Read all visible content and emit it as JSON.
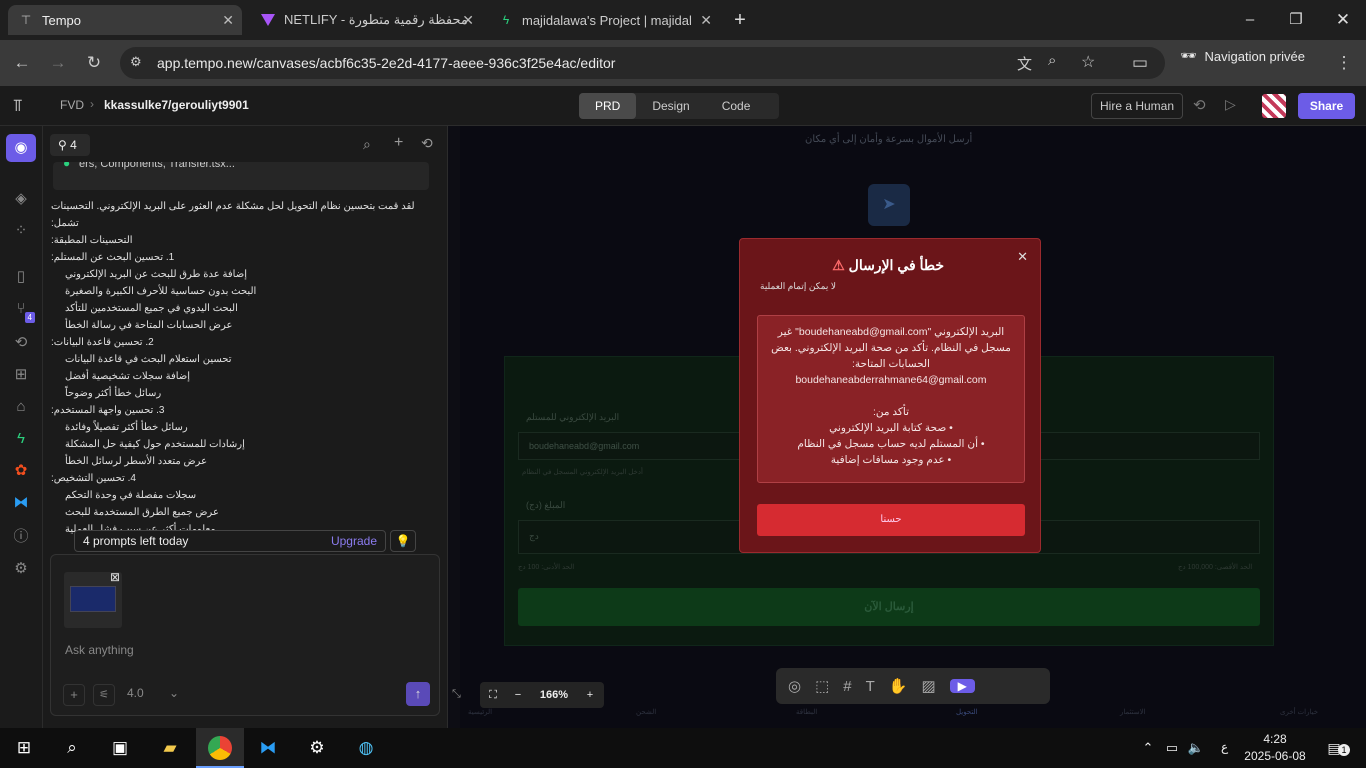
{
  "browser": {
    "tabs": [
      {
        "title": "Tempo",
        "active": true
      },
      {
        "title": "NETLIFY - محفظة رقمية متطورة",
        "active": false
      },
      {
        "title": "majidalawa's Project | majidalaw",
        "active": false
      }
    ],
    "url": "app.tempo.new/canvases/acbf6c35-2e2d-4177-aeee-936c3f25e4ac/editor",
    "private_label": "Navigation privée"
  },
  "app": {
    "breadcrumb_org": "FVD",
    "breadcrumb_project": "kkassulke7/gerouliyt9901",
    "modes": [
      {
        "label": "PRD"
      },
      {
        "label": "Design"
      },
      {
        "label": "Code"
      }
    ],
    "code_badge": "4",
    "hire_label": "Hire a Human",
    "share_label": "Share",
    "rail_badge": "4"
  },
  "chat": {
    "count": "4",
    "hidden_row": "ers, Components, Transfer.tsx...",
    "intro": "لقد قمت بتحسين نظام التحويل لحل مشكلة عدم العثور على البريد الإلكتروني. التحسينات تشمل:",
    "applied_title": "التحسينات المطبقة:",
    "sections": [
      {
        "title": "1. تحسين البحث عن المستلم:",
        "items": [
          "إضافة عدة طرق للبحث عن البريد الإلكتروني",
          "البحث بدون حساسية للأحرف الكبيرة والصغيرة",
          "البحث اليدوي في جميع المستخدمين للتأكد",
          "عرض الحسابات المتاحة في رسالة الخطأ"
        ]
      },
      {
        "title": "2. تحسين قاعدة البيانات:",
        "items": [
          "تحسين استعلام البحث في قاعدة البيانات",
          "إضافة سجلات تشخيصية أفضل",
          "رسائل خطأ أكثر وضوحاً"
        ]
      },
      {
        "title": "3. تحسين واجهة المستخدم:",
        "items": [
          "رسائل خطأ أكثر تفصيلاً وفائدة",
          "إرشادات للمستخدم حول كيفية حل المشكلة",
          "عرض متعدد الأسطر لرسائل الخطأ"
        ]
      },
      {
        "title": "4. تحسين التشخيص:",
        "items": [
          "سجلات مفصلة في وحدة التحكم",
          "عرض جميع الطرق المستخدمة للبحث",
          "معلومات أكثر عن سبب فشل العملية"
        ]
      }
    ],
    "prompts_left": "4 prompts left today",
    "upgrade_label": "Upgrade",
    "placeholder": "Ask anything",
    "model": "4.0"
  },
  "preview": {
    "header_sub": "أرسل الأموال بسرعة وأمان إلى أي مكان",
    "email_label": "البريد الإلكتروني للمستلم",
    "email_value": "boudehaneabd@gmail.com",
    "email_hint": "أدخل البريد الإلكتروني المسجل في النظام",
    "amount_label": "المبلغ (دج)",
    "amount_placeholder": "دج",
    "min_note": "الحد الأدنى: 100 دج",
    "max_note": "الحد الأقصى: 100,000 دج",
    "send_btn": "إرسال الآن",
    "nav": [
      "الرئيسية",
      "الشحن",
      "البطاقة",
      "التحويل",
      "الاستثمار",
      "خيارات أخرى"
    ]
  },
  "modal": {
    "title": "خطأ في الإرسال",
    "subtitle": "لا يمكن إتمام العملية",
    "line1": "البريد الإلكتروني \"boudehaneabd@gmail.com\" غير مسجل في النظام. تأكد من صحة البريد الإلكتروني. بعض الحسابات المتاحة:",
    "account": "boudehaneabderrahmane64@gmail.com",
    "check_title": "تأكد من:",
    "checks": [
      "• صحة كتابة البريد الإلكتروني",
      "• أن المستلم لديه حساب مسجل في النظام",
      "• عدم وجود مسافات إضافية"
    ],
    "button": "حسنا"
  },
  "canvas": {
    "zoom": "166%"
  },
  "taskbar": {
    "ime": "ع",
    "time": "4:28",
    "date": "2025-06-08",
    "notif": "1"
  },
  "colors": {
    "accent": "#6c5ce7",
    "modal_bg": "#6b1519",
    "modal_btn": "#d62b31"
  }
}
